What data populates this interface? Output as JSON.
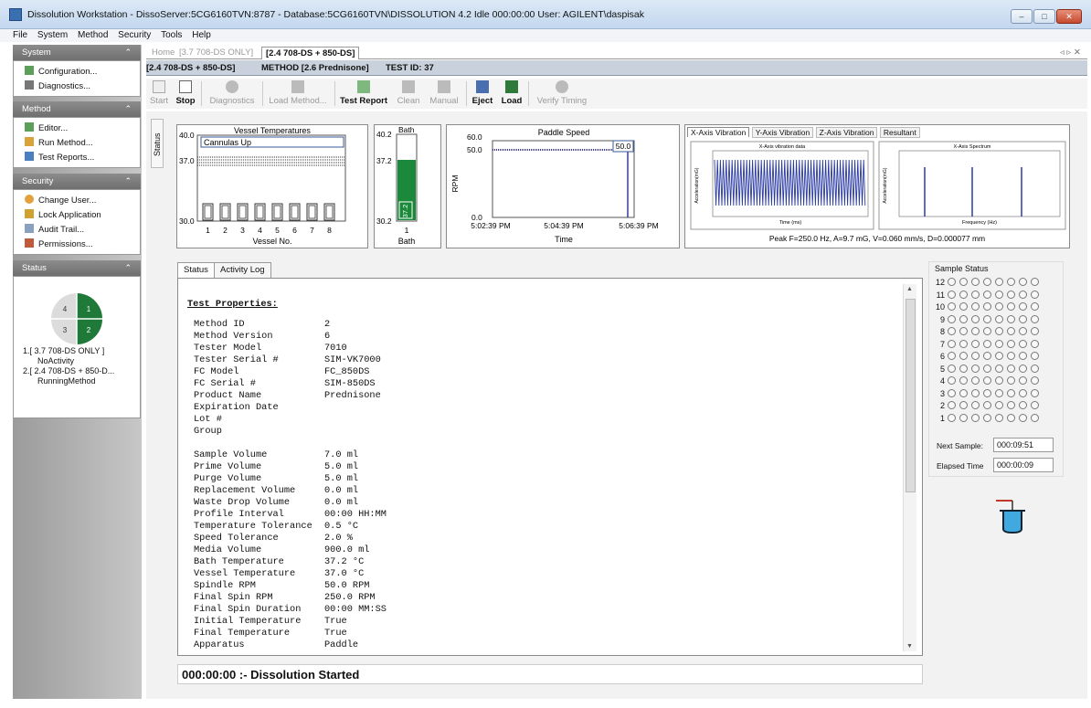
{
  "window": {
    "title": "Dissolution Workstation - DissoServer:5CG6160TVN:8787 - Database:5CG6160TVN\\DISSOLUTION 4.2   Idle 000:00:00  User: AGILENT\\daspisak",
    "min": "–",
    "max": "□",
    "close": "✕"
  },
  "menu": [
    "File",
    "System",
    "Method",
    "Security",
    "Tools",
    "Help"
  ],
  "sidebar": {
    "groups": [
      {
        "title": "System",
        "items": [
          "Configuration...",
          "Diagnostics..."
        ]
      },
      {
        "title": "Method",
        "items": [
          "Editor...",
          "Run Method...",
          "Test Reports..."
        ]
      },
      {
        "title": "Security",
        "items": [
          "Change User...",
          "Lock Application",
          "Audit Trail...",
          "Permissions..."
        ]
      },
      {
        "title": "Status",
        "items": []
      }
    ],
    "pie_labels": [
      "4",
      "1",
      "3",
      "2"
    ],
    "runs": [
      {
        "name": "1.[ 3.7 708-DS ONLY ]",
        "state": "NoActivity"
      },
      {
        "name": "2.[ 2.4 708-DS + 850-D...",
        "state": "RunningMethod"
      }
    ]
  },
  "tabs": {
    "items": [
      "Home",
      "[3.7 708-DS ONLY]",
      "[2.4 708-DS + 850-DS]"
    ],
    "nav": "◃ ▹ ✕"
  },
  "info": {
    "setup": "[2.4 708-DS + 850-DS]",
    "method": "METHOD [2.6 Prednisone]",
    "test_id": "TEST ID: 37"
  },
  "toolbar": [
    {
      "label": "Start",
      "icon": "start-icon",
      "enabled": false
    },
    {
      "label": "Stop",
      "icon": "stop-icon",
      "enabled": true
    },
    {
      "label": "Diagnostics",
      "icon": "diagnostics-icon",
      "enabled": false
    },
    {
      "label": "Load Method...",
      "icon": "load-method-icon",
      "enabled": false
    },
    {
      "label": "Test Report",
      "icon": "test-report-icon",
      "enabled": true
    },
    {
      "label": "Clean",
      "icon": "clean-icon",
      "enabled": false
    },
    {
      "label": "Manual",
      "icon": "manual-icon",
      "enabled": false
    },
    {
      "label": "Eject",
      "icon": "eject-icon",
      "enabled": true
    },
    {
      "label": "Load",
      "icon": "load-icon",
      "enabled": true
    },
    {
      "label": "Verify Timing",
      "icon": "verify-timing-icon",
      "enabled": false
    }
  ],
  "side_tab": "Status",
  "vessel_temps": {
    "title": "Vessel Temperatures",
    "banner": "Cannulas Up",
    "ymin": "30.0",
    "ymid": "37.0",
    "ymax": "40.0",
    "vessels": [
      "1",
      "2",
      "3",
      "4",
      "5",
      "6",
      "7",
      "8"
    ],
    "xlabel": "Vessel No."
  },
  "bath": {
    "title": "Bath",
    "ymin": "30.2",
    "ymid": "37.2",
    "ymax": "40.2",
    "value": "37.2",
    "level": 0.7,
    "xtick": "1",
    "xlabel": "Bath"
  },
  "paddle": {
    "title": "Paddle Speed",
    "ylabel": "RPM",
    "yticks": [
      "60.0",
      "50.0",
      "0.0"
    ],
    "xticks": [
      "5:02:39 PM",
      "5:04:39 PM",
      "5:06:39 PM"
    ],
    "xlabel": "Time",
    "current": "50.0"
  },
  "vibration": {
    "tabs": [
      "X-Axis Vibration",
      "Y-Axis Vibration",
      "Z-Axis Vibration",
      "Resultant"
    ],
    "left_title": "X-Axis vibration data",
    "right_title": "X-Axis Spectrum",
    "left_xlabel": "Time (ms)",
    "right_xlabel": "Frequency (Hz)",
    "ylabel": "Acceleration(mG)",
    "peak": "Peak F=250.0 Hz, A=9.7 mG, V=0.060 mm/s, D=0.000077 mm"
  },
  "lower_tabs": [
    "Status",
    "Activity Log"
  ],
  "properties": {
    "heading": "Test Properties:",
    "rows": [
      [
        "Method ID",
        "2"
      ],
      [
        "Method Version",
        "6"
      ],
      [
        "Tester Model",
        "7010"
      ],
      [
        "Tester Serial #",
        "SIM-VK7000"
      ],
      [
        "FC Model",
        "FC_850DS"
      ],
      [
        "FC Serial #",
        "SIM-850DS"
      ],
      [
        "Product Name",
        "Prednisone"
      ],
      [
        "Expiration Date",
        ""
      ],
      [
        "Lot #",
        ""
      ],
      [
        "Group",
        ""
      ],
      [
        "",
        ""
      ],
      [
        "Sample Volume",
        "7.0 ml"
      ],
      [
        "Prime Volume",
        "5.0 ml"
      ],
      [
        "Purge Volume",
        "5.0 ml"
      ],
      [
        "Replacement Volume",
        "0.0 ml"
      ],
      [
        "Waste Drop Volume",
        "0.0 ml"
      ],
      [
        "Profile Interval",
        "00:00 HH:MM"
      ],
      [
        "Temperature Tolerance",
        "0.5 °C"
      ],
      [
        "Speed Tolerance",
        "2.0 %"
      ],
      [
        "Media Volume",
        "900.0 ml"
      ],
      [
        "Bath Temperature",
        "37.2 °C"
      ],
      [
        "Vessel Temperature",
        "37.0 °C"
      ],
      [
        "Spindle RPM",
        "50.0 RPM"
      ],
      [
        "Final Spin RPM",
        "250.0 RPM"
      ],
      [
        "Final Spin Duration",
        "00:00 MM:SS"
      ],
      [
        "Initial Temperature",
        "True"
      ],
      [
        "Final Temperature",
        "True"
      ],
      [
        "Apparatus",
        "Paddle"
      ]
    ]
  },
  "sample_status": {
    "title": "Sample Status",
    "rows": [
      "12",
      "11",
      "10",
      "9",
      "8",
      "7",
      "6",
      "5",
      "4",
      "3",
      "2",
      "1"
    ],
    "columns": 8,
    "next_label": "Next Sample:",
    "next_value": "000:09:51",
    "elapsed_label": "Elapsed Time",
    "elapsed_value": "000:00:09"
  },
  "status_message": "000:00:00 :- Dissolution Started"
}
